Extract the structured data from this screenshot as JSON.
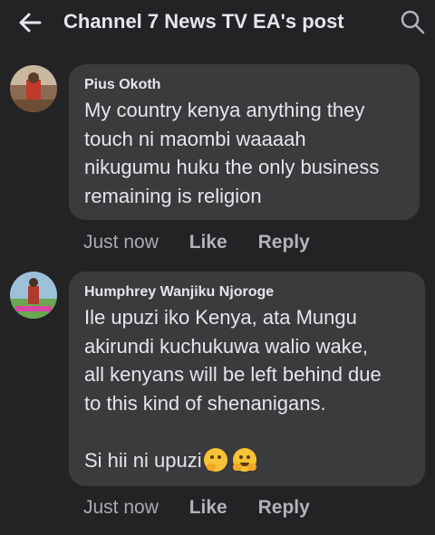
{
  "header": {
    "title": "Channel 7 News TV EA's post",
    "back_icon": "arrow-left-icon",
    "search_icon": "search-icon"
  },
  "comments": [
    {
      "author": "Pius Okoth",
      "lines": [
        "My country kenya anything they",
        "touch ni maombi waaaah",
        "nikugumu huku the only business",
        "remaining is religion"
      ],
      "time": "Just now",
      "like_label": "Like",
      "reply_label": "Reply"
    },
    {
      "author": "Humphrey Wanjiku Njoroge",
      "lines": [
        "Ile upuzi iko Kenya, ata Mungu",
        "akirundi kuchukuwa walio wake,",
        "all kenyans will be left behind due",
        "to this kind of shenanigans."
      ],
      "last_line": "Si hii ni upuzi",
      "emojis": [
        "thinking-face-icon",
        "hugging-face-icon"
      ],
      "time": "Just now",
      "like_label": "Like",
      "reply_label": "Reply"
    }
  ],
  "colors": {
    "background": "#232325",
    "bubble": "#3a3b3c",
    "text": "#e4e6eb",
    "muted": "#a8abb0"
  }
}
